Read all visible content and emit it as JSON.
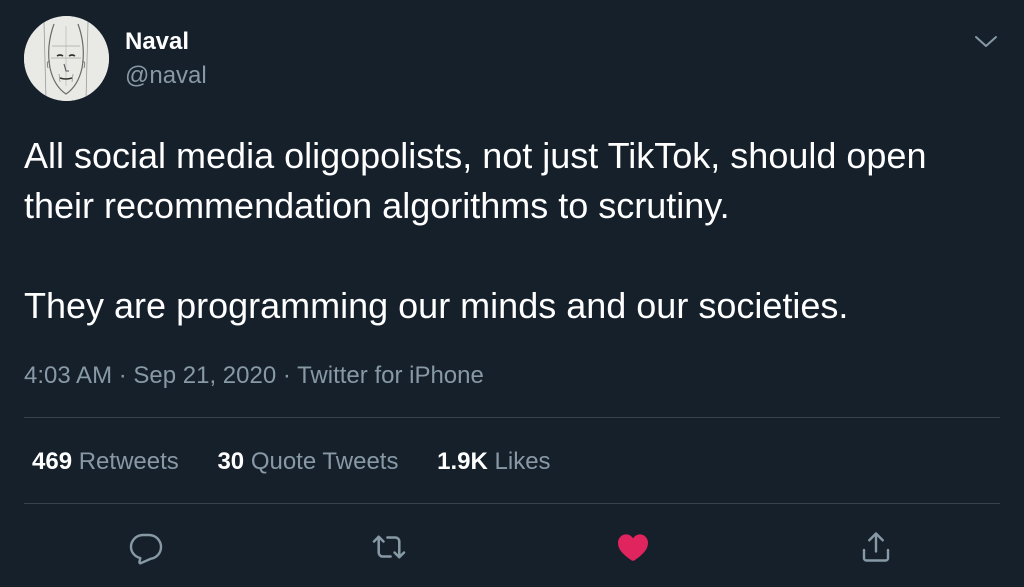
{
  "user": {
    "display_name": "Naval",
    "handle": "@naval",
    "avatar_icon": "sketched-face-avatar"
  },
  "tweet": {
    "paragraphs": [
      "All social media oligopolists, not just TikTok, should open their recommendation algorithms to scrutiny.",
      "They are programming our minds and our societies."
    ]
  },
  "meta": {
    "time": "4:03 AM",
    "separator": " · ",
    "date": "Sep 21, 2020",
    "source": "Twitter for iPhone"
  },
  "stats": {
    "retweets_count": "469",
    "retweets_label": "Retweets",
    "quotes_count": "30",
    "quotes_label": "Quote Tweets",
    "likes_count": "1.9K",
    "likes_label": "Likes"
  },
  "actions": {
    "reply_icon": "reply-icon",
    "retweet_icon": "retweet-icon",
    "like_icon": "heart-icon",
    "share_icon": "share-icon",
    "liked": true
  },
  "colors": {
    "background": "#15202b",
    "secondary_text": "#8899a6",
    "divider": "#38444d",
    "like": "#e0245e"
  }
}
